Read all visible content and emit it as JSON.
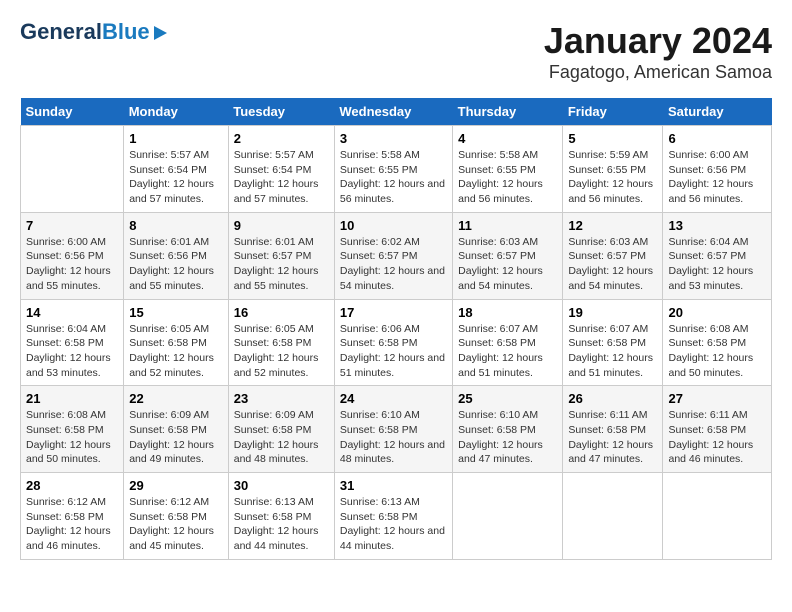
{
  "logo": {
    "line1": "General",
    "line2": "Blue"
  },
  "title": "January 2024",
  "subtitle": "Fagatogo, American Samoa",
  "days_of_week": [
    "Sunday",
    "Monday",
    "Tuesday",
    "Wednesday",
    "Thursday",
    "Friday",
    "Saturday"
  ],
  "weeks": [
    [
      {
        "num": "",
        "sunrise": "",
        "sunset": "",
        "daylight": ""
      },
      {
        "num": "1",
        "sunrise": "Sunrise: 5:57 AM",
        "sunset": "Sunset: 6:54 PM",
        "daylight": "Daylight: 12 hours and 57 minutes."
      },
      {
        "num": "2",
        "sunrise": "Sunrise: 5:57 AM",
        "sunset": "Sunset: 6:54 PM",
        "daylight": "Daylight: 12 hours and 57 minutes."
      },
      {
        "num": "3",
        "sunrise": "Sunrise: 5:58 AM",
        "sunset": "Sunset: 6:55 PM",
        "daylight": "Daylight: 12 hours and 56 minutes."
      },
      {
        "num": "4",
        "sunrise": "Sunrise: 5:58 AM",
        "sunset": "Sunset: 6:55 PM",
        "daylight": "Daylight: 12 hours and 56 minutes."
      },
      {
        "num": "5",
        "sunrise": "Sunrise: 5:59 AM",
        "sunset": "Sunset: 6:55 PM",
        "daylight": "Daylight: 12 hours and 56 minutes."
      },
      {
        "num": "6",
        "sunrise": "Sunrise: 6:00 AM",
        "sunset": "Sunset: 6:56 PM",
        "daylight": "Daylight: 12 hours and 56 minutes."
      }
    ],
    [
      {
        "num": "7",
        "sunrise": "Sunrise: 6:00 AM",
        "sunset": "Sunset: 6:56 PM",
        "daylight": "Daylight: 12 hours and 55 minutes."
      },
      {
        "num": "8",
        "sunrise": "Sunrise: 6:01 AM",
        "sunset": "Sunset: 6:56 PM",
        "daylight": "Daylight: 12 hours and 55 minutes."
      },
      {
        "num": "9",
        "sunrise": "Sunrise: 6:01 AM",
        "sunset": "Sunset: 6:57 PM",
        "daylight": "Daylight: 12 hours and 55 minutes."
      },
      {
        "num": "10",
        "sunrise": "Sunrise: 6:02 AM",
        "sunset": "Sunset: 6:57 PM",
        "daylight": "Daylight: 12 hours and 54 minutes."
      },
      {
        "num": "11",
        "sunrise": "Sunrise: 6:03 AM",
        "sunset": "Sunset: 6:57 PM",
        "daylight": "Daylight: 12 hours and 54 minutes."
      },
      {
        "num": "12",
        "sunrise": "Sunrise: 6:03 AM",
        "sunset": "Sunset: 6:57 PM",
        "daylight": "Daylight: 12 hours and 54 minutes."
      },
      {
        "num": "13",
        "sunrise": "Sunrise: 6:04 AM",
        "sunset": "Sunset: 6:57 PM",
        "daylight": "Daylight: 12 hours and 53 minutes."
      }
    ],
    [
      {
        "num": "14",
        "sunrise": "Sunrise: 6:04 AM",
        "sunset": "Sunset: 6:58 PM",
        "daylight": "Daylight: 12 hours and 53 minutes."
      },
      {
        "num": "15",
        "sunrise": "Sunrise: 6:05 AM",
        "sunset": "Sunset: 6:58 PM",
        "daylight": "Daylight: 12 hours and 52 minutes."
      },
      {
        "num": "16",
        "sunrise": "Sunrise: 6:05 AM",
        "sunset": "Sunset: 6:58 PM",
        "daylight": "Daylight: 12 hours and 52 minutes."
      },
      {
        "num": "17",
        "sunrise": "Sunrise: 6:06 AM",
        "sunset": "Sunset: 6:58 PM",
        "daylight": "Daylight: 12 hours and 51 minutes."
      },
      {
        "num": "18",
        "sunrise": "Sunrise: 6:07 AM",
        "sunset": "Sunset: 6:58 PM",
        "daylight": "Daylight: 12 hours and 51 minutes."
      },
      {
        "num": "19",
        "sunrise": "Sunrise: 6:07 AM",
        "sunset": "Sunset: 6:58 PM",
        "daylight": "Daylight: 12 hours and 51 minutes."
      },
      {
        "num": "20",
        "sunrise": "Sunrise: 6:08 AM",
        "sunset": "Sunset: 6:58 PM",
        "daylight": "Daylight: 12 hours and 50 minutes."
      }
    ],
    [
      {
        "num": "21",
        "sunrise": "Sunrise: 6:08 AM",
        "sunset": "Sunset: 6:58 PM",
        "daylight": "Daylight: 12 hours and 50 minutes."
      },
      {
        "num": "22",
        "sunrise": "Sunrise: 6:09 AM",
        "sunset": "Sunset: 6:58 PM",
        "daylight": "Daylight: 12 hours and 49 minutes."
      },
      {
        "num": "23",
        "sunrise": "Sunrise: 6:09 AM",
        "sunset": "Sunset: 6:58 PM",
        "daylight": "Daylight: 12 hours and 48 minutes."
      },
      {
        "num": "24",
        "sunrise": "Sunrise: 6:10 AM",
        "sunset": "Sunset: 6:58 PM",
        "daylight": "Daylight: 12 hours and 48 minutes."
      },
      {
        "num": "25",
        "sunrise": "Sunrise: 6:10 AM",
        "sunset": "Sunset: 6:58 PM",
        "daylight": "Daylight: 12 hours and 47 minutes."
      },
      {
        "num": "26",
        "sunrise": "Sunrise: 6:11 AM",
        "sunset": "Sunset: 6:58 PM",
        "daylight": "Daylight: 12 hours and 47 minutes."
      },
      {
        "num": "27",
        "sunrise": "Sunrise: 6:11 AM",
        "sunset": "Sunset: 6:58 PM",
        "daylight": "Daylight: 12 hours and 46 minutes."
      }
    ],
    [
      {
        "num": "28",
        "sunrise": "Sunrise: 6:12 AM",
        "sunset": "Sunset: 6:58 PM",
        "daylight": "Daylight: 12 hours and 46 minutes."
      },
      {
        "num": "29",
        "sunrise": "Sunrise: 6:12 AM",
        "sunset": "Sunset: 6:58 PM",
        "daylight": "Daylight: 12 hours and 45 minutes."
      },
      {
        "num": "30",
        "sunrise": "Sunrise: 6:13 AM",
        "sunset": "Sunset: 6:58 PM",
        "daylight": "Daylight: 12 hours and 44 minutes."
      },
      {
        "num": "31",
        "sunrise": "Sunrise: 6:13 AM",
        "sunset": "Sunset: 6:58 PM",
        "daylight": "Daylight: 12 hours and 44 minutes."
      },
      {
        "num": "",
        "sunrise": "",
        "sunset": "",
        "daylight": ""
      },
      {
        "num": "",
        "sunrise": "",
        "sunset": "",
        "daylight": ""
      },
      {
        "num": "",
        "sunrise": "",
        "sunset": "",
        "daylight": ""
      }
    ]
  ]
}
